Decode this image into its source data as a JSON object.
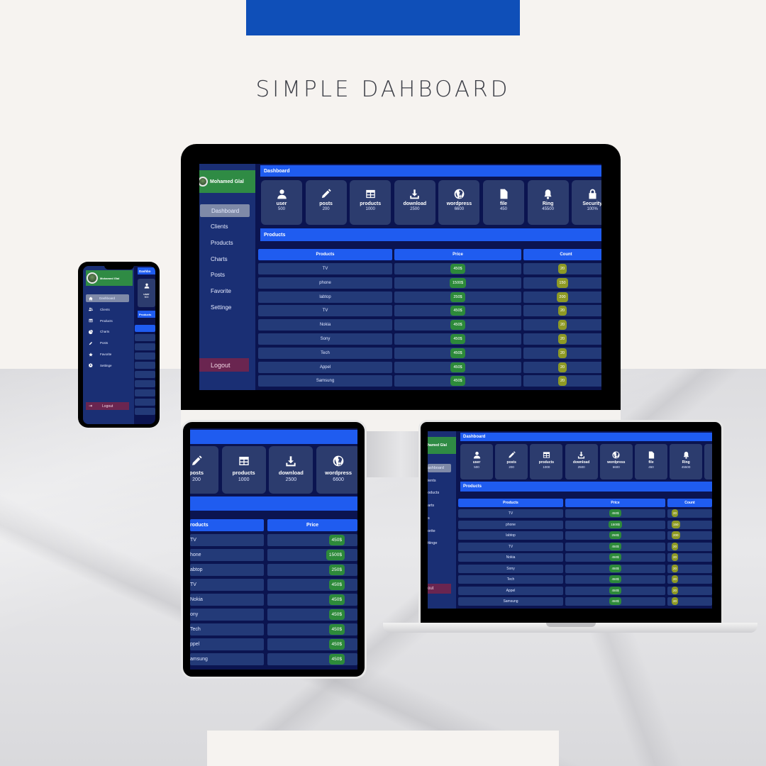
{
  "page": {
    "title": "SIMPLE DAHBOARD"
  },
  "app": {
    "user_name": "Mohamed Glal",
    "nav": [
      {
        "label": "Dashboard",
        "icon": "home-icon",
        "active": true
      },
      {
        "label": "Clients",
        "icon": "users-icon",
        "active": false
      },
      {
        "label": "Products",
        "icon": "table-icon",
        "active": false
      },
      {
        "label": "Charts",
        "icon": "pie-chart-icon",
        "active": false
      },
      {
        "label": "Posts",
        "icon": "pen-icon",
        "active": false
      },
      {
        "label": "Favorite",
        "icon": "star-icon",
        "active": false
      },
      {
        "label": "Settinge",
        "icon": "gear-icon",
        "active": false
      }
    ],
    "logout_label": "Logout",
    "phone_logout_label": "Logout",
    "dashboard_header": "Dashboard",
    "products_header": "Products",
    "cards": [
      {
        "label": "user",
        "value": "500",
        "icon": "user-icon"
      },
      {
        "label": "posts",
        "value": "200",
        "icon": "pencil-icon"
      },
      {
        "label": "products",
        "value": "1000",
        "icon": "table-icon"
      },
      {
        "label": "download",
        "value": "2500",
        "icon": "download-icon"
      },
      {
        "label": "wordpress",
        "value": "6600",
        "icon": "wordpress-icon"
      },
      {
        "label": "file",
        "value": "450",
        "icon": "file-icon"
      },
      {
        "label": "Ring",
        "value": "45500",
        "icon": "bell-icon"
      },
      {
        "label": "Security",
        "value": "100%",
        "icon": "lock-icon"
      }
    ],
    "table": {
      "columns": [
        "Products",
        "Price",
        "Count"
      ],
      "rows": [
        {
          "product": "TV",
          "price": "450$",
          "count": "20"
        },
        {
          "product": "phone",
          "price": "1500$",
          "count": "150"
        },
        {
          "product": "labtop",
          "price": "250$",
          "count": "200"
        },
        {
          "product": "TV",
          "price": "450$",
          "count": "20"
        },
        {
          "product": "Nokia",
          "price": "450$",
          "count": "20"
        },
        {
          "product": "Sony",
          "price": "450$",
          "count": "20"
        },
        {
          "product": "Tech",
          "price": "450$",
          "count": "20"
        },
        {
          "product": "Appel",
          "price": "450$",
          "count": "20"
        },
        {
          "product": "Samsung",
          "price": "450$",
          "count": "20"
        }
      ]
    },
    "phone": {
      "header_label": "Dashbo",
      "card_value": "500",
      "products_label": "Products"
    },
    "tablet": {
      "row_labels": [
        "TV",
        "hone",
        "abtop",
        "TV",
        "Nokia",
        "ony",
        "Tech",
        "ppel",
        "amsung"
      ],
      "first_column_label": "roducts",
      "card_posts_value": "200"
    },
    "laptop": {
      "profile_label": "hamed Glal",
      "nav_labels": [
        "ashboard",
        "ients",
        "oducts",
        "arts",
        "s",
        "orite",
        "ttinge"
      ],
      "logout_label": "out"
    }
  },
  "colors": {
    "header_blue": "#1f5cf0",
    "sidebar": "#1a2f74",
    "profile_green": "#2f8b44",
    "price_green": "#2d8a3a",
    "count_olive": "#8e9a25",
    "logout": "#6a2550",
    "top_bar": "#0f4fb8"
  }
}
